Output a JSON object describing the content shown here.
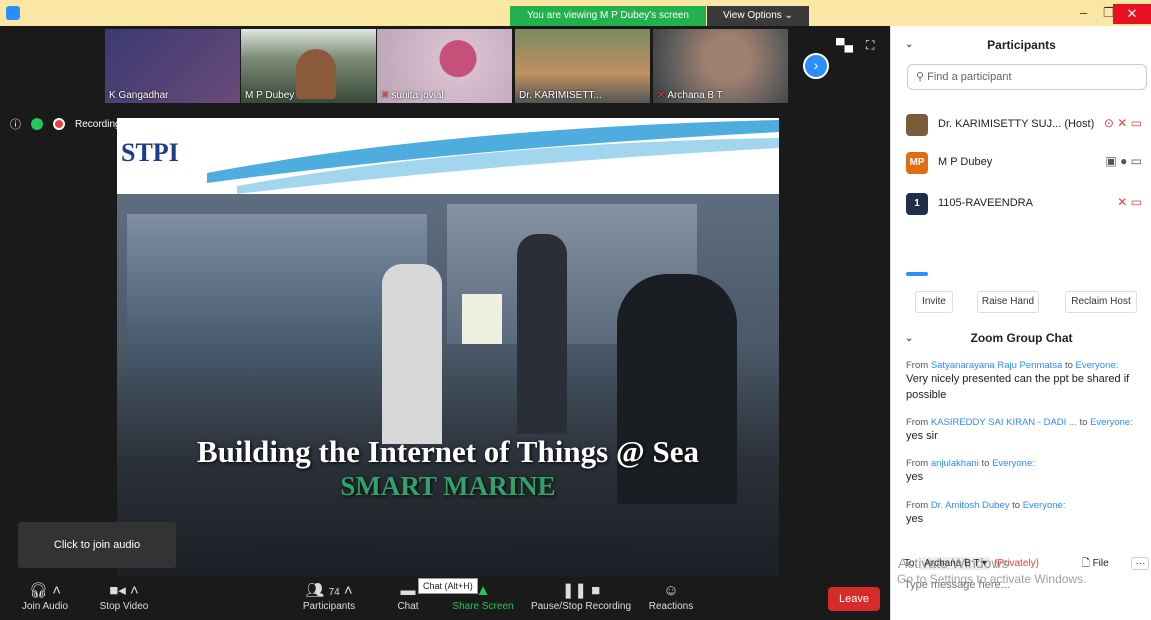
{
  "banner": {
    "viewing": "You are viewing M P Dubey's screen",
    "view_options": "View Options ⌄"
  },
  "window": {
    "minimize": "–",
    "restore": "❐",
    "close": "✕"
  },
  "thumbnails": [
    {
      "name": "K Gangadhar",
      "muted": false,
      "bg": "#3f3f6a"
    },
    {
      "name": "M P Dubey",
      "muted": false,
      "bg": "#4d5a4a"
    },
    {
      "name": "sunita jovial",
      "muted": true,
      "bg": "#8a6f86"
    },
    {
      "name": "Dr. KARIMISETT...",
      "muted": false,
      "bg": "#6b7054"
    },
    {
      "name": "Archana B T",
      "muted": true,
      "bg": "#4a4a4a"
    }
  ],
  "status": {
    "recording": "Recording..."
  },
  "slide": {
    "logo": "STPI",
    "title": "Building the Internet of Things @ Sea",
    "subtitle": "SMART MARINE"
  },
  "tooltip": {
    "audio": "Click to join audio",
    "chat": "Chat (Alt+H)"
  },
  "toolbar": {
    "join_audio": "Join Audio",
    "stop_video": "Stop Video",
    "participants_count": "74",
    "participants": "Participants",
    "chat": "Chat",
    "share_screen": "Share Screen",
    "pause_record": "Pause/Stop Recording",
    "reactions": "Reactions",
    "leave": "Leave"
  },
  "panel": {
    "title": "Participants",
    "search_placeholder": "Find a participant",
    "participants": [
      {
        "name": "Dr. KARIMISETTY SUJ... (Host)",
        "avatar": "",
        "avatar_color": "#7a5b3a",
        "icons": "⊙ ✕ ▭"
      },
      {
        "name": "M P Dubey",
        "avatar": "MP",
        "avatar_color": "#e26d10",
        "icons": "▣ ● ▭"
      },
      {
        "name": "1105-RAVEENDRA",
        "avatar": "1",
        "avatar_color": "#1f2f4a",
        "icons": "✕ ▭"
      }
    ],
    "buttons": {
      "invite": "Invite",
      "raise_hand": "Raise Hand",
      "reclaim_host": "Reclaim Host"
    },
    "chat_title": "Zoom Group Chat",
    "messages": [
      {
        "from": "Satyanarayana Raju Penmatsa",
        "to": "Everyone:",
        "text": "Very nicely presented can the ppt be shared if possible"
      },
      {
        "from": "KASIREDDY SAI KIRAN - DADI ...",
        "to": "Everyone:",
        "text": "yes sir"
      },
      {
        "from": "anjulakhani",
        "to": "Everyone:",
        "text": "yes"
      },
      {
        "from": "Dr. Amitosh Dubey",
        "to": "Everyone:",
        "text": "yes"
      }
    ],
    "to_label": "To:",
    "to_target": "Archana B T ▾",
    "privately": "(Privately)",
    "file": "File",
    "more": "···",
    "input_placeholder": "Type message here...",
    "watermark_1": "Activate Windows",
    "watermark_2": "Go to Settings to activate Windows."
  }
}
